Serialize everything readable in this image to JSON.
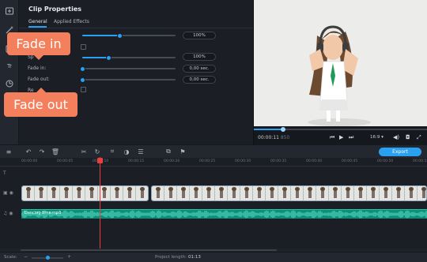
{
  "clip_properties": {
    "title": "Clip Properties",
    "tabs": [
      {
        "label": "General",
        "active": true
      },
      {
        "label": "Applied Effects",
        "active": false
      }
    ],
    "rows": [
      {
        "label": "",
        "value": "100%",
        "level_percent": 40
      },
      {
        "label": "",
        "checkbox": true
      },
      {
        "label": "Sp",
        "value": "100%",
        "level_percent": 28
      },
      {
        "label": "Fade in:",
        "value": "0,00 sec.",
        "level_percent": 0
      },
      {
        "label": "Fade out:",
        "value": "0,00 sec.",
        "level_percent": 0
      },
      {
        "label": "Re",
        "checkbox": true
      }
    ]
  },
  "callouts": {
    "fade_in": "Fade in",
    "fade_out": "Fade out",
    "color": "#f47f5c"
  },
  "left_rail": {
    "icons": [
      "import-icon",
      "magic-wand-icon",
      "filter-icon",
      "text-icon",
      "clock-icon"
    ],
    "text_icon_label": "Tr"
  },
  "preview": {
    "timecode": "00:00:11",
    "timecode_frames": "850",
    "progress_fraction": 0.17,
    "aspect_ratio": "16:9 ▾",
    "buttons": [
      "prev-icon",
      "play-icon",
      "next-icon",
      "volume-icon",
      "snapshot-icon",
      "fullscreen-icon"
    ]
  },
  "timeline_toolbar": {
    "export_label": "Export",
    "accent": "#2aa0f0"
  },
  "ruler": {
    "ticks": [
      "00:00:00",
      "00:00:05",
      "00:00:10",
      "00:00:15",
      "00:00:20",
      "00:00:25",
      "00:00:30",
      "00:00:35",
      "00:00:40",
      "00:00:45",
      "00:00:50",
      "00:00:55"
    ]
  },
  "audio_track": {
    "title": "Dancing time.mp3",
    "color": "#0c8f7a"
  },
  "status": {
    "scale_label": "Scale:",
    "project_length_label": "Project length:",
    "project_length": "01:13"
  }
}
